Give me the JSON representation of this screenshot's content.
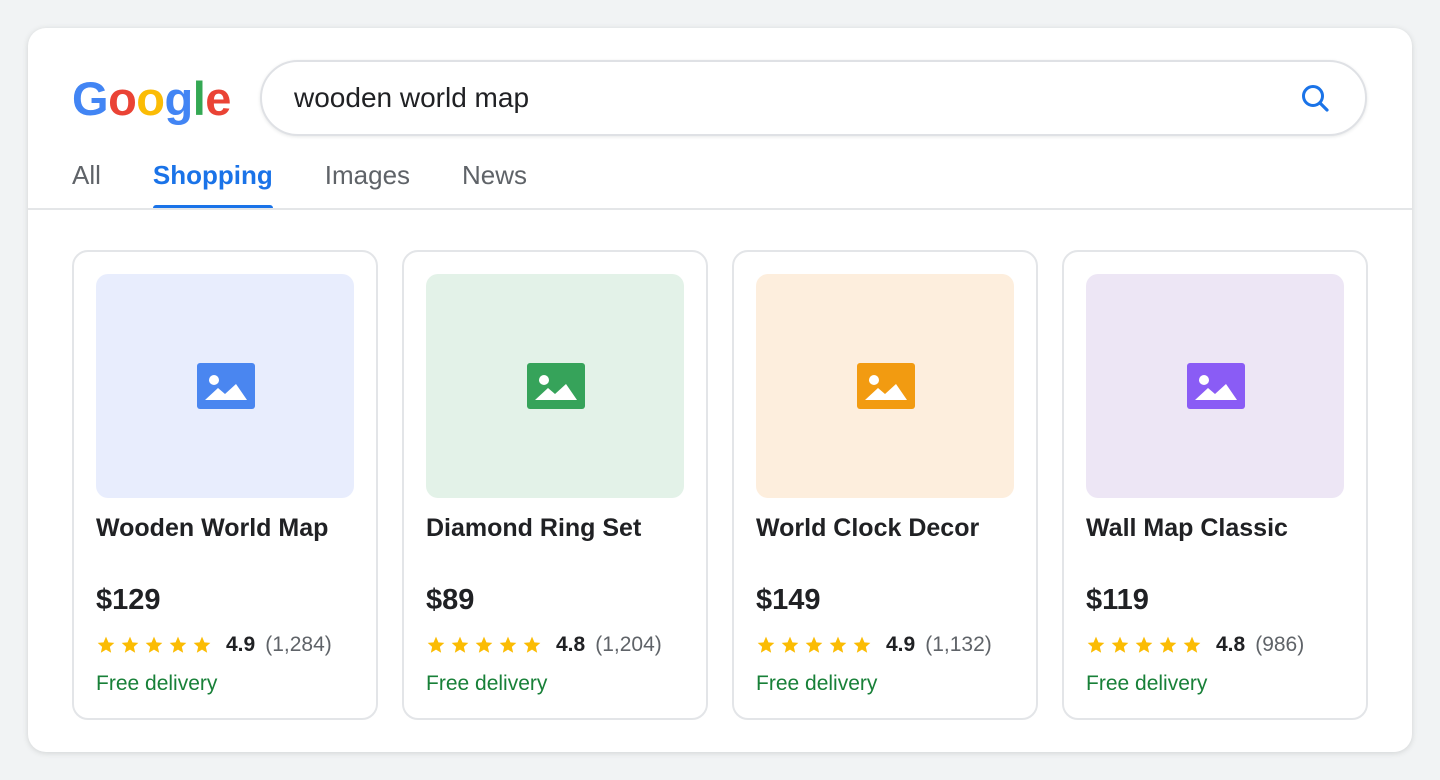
{
  "logo": {
    "letters": [
      "G",
      "o",
      "o",
      "g",
      "l",
      "e"
    ],
    "colors": [
      "#4285f4",
      "#ea4335",
      "#fbbc05",
      "#4285f4",
      "#34a853",
      "#ea4335"
    ]
  },
  "search": {
    "query": "wooden world map",
    "icon": "search-icon"
  },
  "tabs": [
    {
      "label": "All",
      "active": false
    },
    {
      "label": "Shopping",
      "active": true
    },
    {
      "label": "Images",
      "active": false
    },
    {
      "label": "News",
      "active": false
    }
  ],
  "products": [
    {
      "title": "Wooden World Map",
      "price": "$129",
      "rating": "4.9",
      "stars": 5,
      "reviews": "(1,284)",
      "delivery": "Free delivery",
      "thumb_bg": "#e8edfd",
      "icon_color": "#4a86f0",
      "icon": "image-icon"
    },
    {
      "title": "Diamond Ring Set",
      "price": "$89",
      "rating": "4.8",
      "stars": 5,
      "reviews": "(1,204)",
      "delivery": "Free delivery",
      "thumb_bg": "#e3f2e8",
      "icon_color": "#36a35a",
      "icon": "image-icon"
    },
    {
      "title": "World Clock Decor",
      "price": "$149",
      "rating": "4.9",
      "stars": 5,
      "reviews": "(1,132)",
      "delivery": "Free delivery",
      "thumb_bg": "#fdeedd",
      "icon_color": "#f29b11",
      "icon": "image-icon"
    },
    {
      "title": "Wall Map Classic",
      "price": "$119",
      "rating": "4.8",
      "stars": 5,
      "reviews": "(986)",
      "delivery": "Free delivery",
      "thumb_bg": "#ede6f5",
      "icon_color": "#8a5cf5",
      "icon": "image-icon"
    }
  ],
  "colors": {
    "accent": "#1a73e8",
    "star": "#fbbc04",
    "delivery": "#188038"
  }
}
